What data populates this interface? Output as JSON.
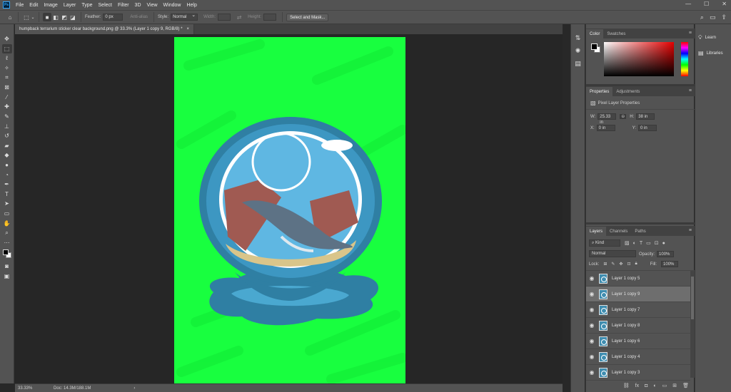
{
  "app": {
    "logo_text": "Ps"
  },
  "menu": [
    "File",
    "Edit",
    "Image",
    "Layer",
    "Type",
    "Select",
    "Filter",
    "3D",
    "View",
    "Window",
    "Help"
  ],
  "window_controls": {
    "minimize": "—",
    "maximize": "☐",
    "close": "✕"
  },
  "options_bar": {
    "feather_label": "Feather:",
    "feather_value": "0 px",
    "antialias_label": "Anti-alias",
    "style_label": "Style:",
    "style_value": "Normal",
    "width_label": "Width:",
    "height_label": "Height:",
    "select_mask_button": "Select and Mask..."
  },
  "document": {
    "tab_title": "humpback terrarium sticker clear background.png @ 33.3% (Layer 1 copy 9, RGB/8) *",
    "tab_close": "×",
    "background_color": "#18ff3f"
  },
  "statusbar": {
    "zoom": "33.33%",
    "doc_info": "Doc: 14.3M/188.1M",
    "arrow": "›"
  },
  "color_panel": {
    "tabs": [
      "Color",
      "Swatches"
    ],
    "menu": "≡"
  },
  "properties_panel": {
    "tabs": [
      "Properties",
      "Adjustments"
    ],
    "menu": "≡",
    "header": "Pixel Layer Properties",
    "w_label": "W:",
    "w_value": "25.33 in",
    "h_label": "H:",
    "h_value": "38 in",
    "x_label": "X:",
    "x_value": "0 in",
    "y_label": "Y:",
    "y_value": "0 in",
    "link_icon": "⊝"
  },
  "layers_panel": {
    "tabs": [
      "Layers",
      "Channels",
      "Paths"
    ],
    "menu": "≡",
    "kind_label": "Kind",
    "blend_mode": "Normal",
    "opacity_label": "Opacity:",
    "opacity_value": "100%",
    "lock_label": "Lock:",
    "fill_label": "Fill:",
    "fill_value": "100%",
    "layers": [
      {
        "name": "Layer 1 copy 5",
        "selected": false
      },
      {
        "name": "Layer 1 copy 9",
        "selected": true
      },
      {
        "name": "Layer 1 copy 7",
        "selected": false
      },
      {
        "name": "Layer 1 copy 8",
        "selected": false
      },
      {
        "name": "Layer 1 copy 6",
        "selected": false
      },
      {
        "name": "Layer 1 copy 4",
        "selected": false
      },
      {
        "name": "Layer 1 copy 3",
        "selected": false
      }
    ]
  },
  "far_right": {
    "learn": "Learn",
    "libraries": "Libraries"
  }
}
